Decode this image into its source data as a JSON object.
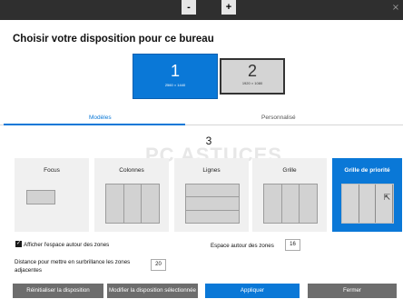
{
  "window": {
    "close_glyph": "×"
  },
  "title": "Choisir votre disposition pour ce bureau",
  "monitors": [
    {
      "number": "1",
      "resolution": "2560 × 1440",
      "selected": true
    },
    {
      "number": "2",
      "resolution": "1920 × 1080",
      "selected": false
    }
  ],
  "tabs": [
    {
      "label": "Modèles",
      "active": true
    },
    {
      "label": "Personnalisé",
      "active": false
    }
  ],
  "zone_count": {
    "value": "3",
    "minus": "-",
    "plus": "+"
  },
  "watermark": "PC ASTUCES",
  "layouts": [
    {
      "label": "Focus",
      "selected": false
    },
    {
      "label": "Colonnes",
      "selected": false
    },
    {
      "label": "Lignes",
      "selected": false
    },
    {
      "label": "Grille",
      "selected": false
    },
    {
      "label": "Grille de priorité",
      "selected": true
    }
  ],
  "options": {
    "show_space_label": "Afficher l'espace autour des zones",
    "show_space_checked": true,
    "space_around_label": "Espace autour des zones",
    "space_around_value": "16",
    "distance_label": "Distance pour mettre en surbrillance les zones adjacentes",
    "distance_value": "20"
  },
  "buttons": {
    "reset": "Réinitialiser la disposition",
    "modify": "Modifier la disposition sélectionnée",
    "apply": "Appliquer",
    "close": "Fermer"
  },
  "colors": {
    "accent": "#0a78d7",
    "button_gray": "#6d6d6d"
  }
}
